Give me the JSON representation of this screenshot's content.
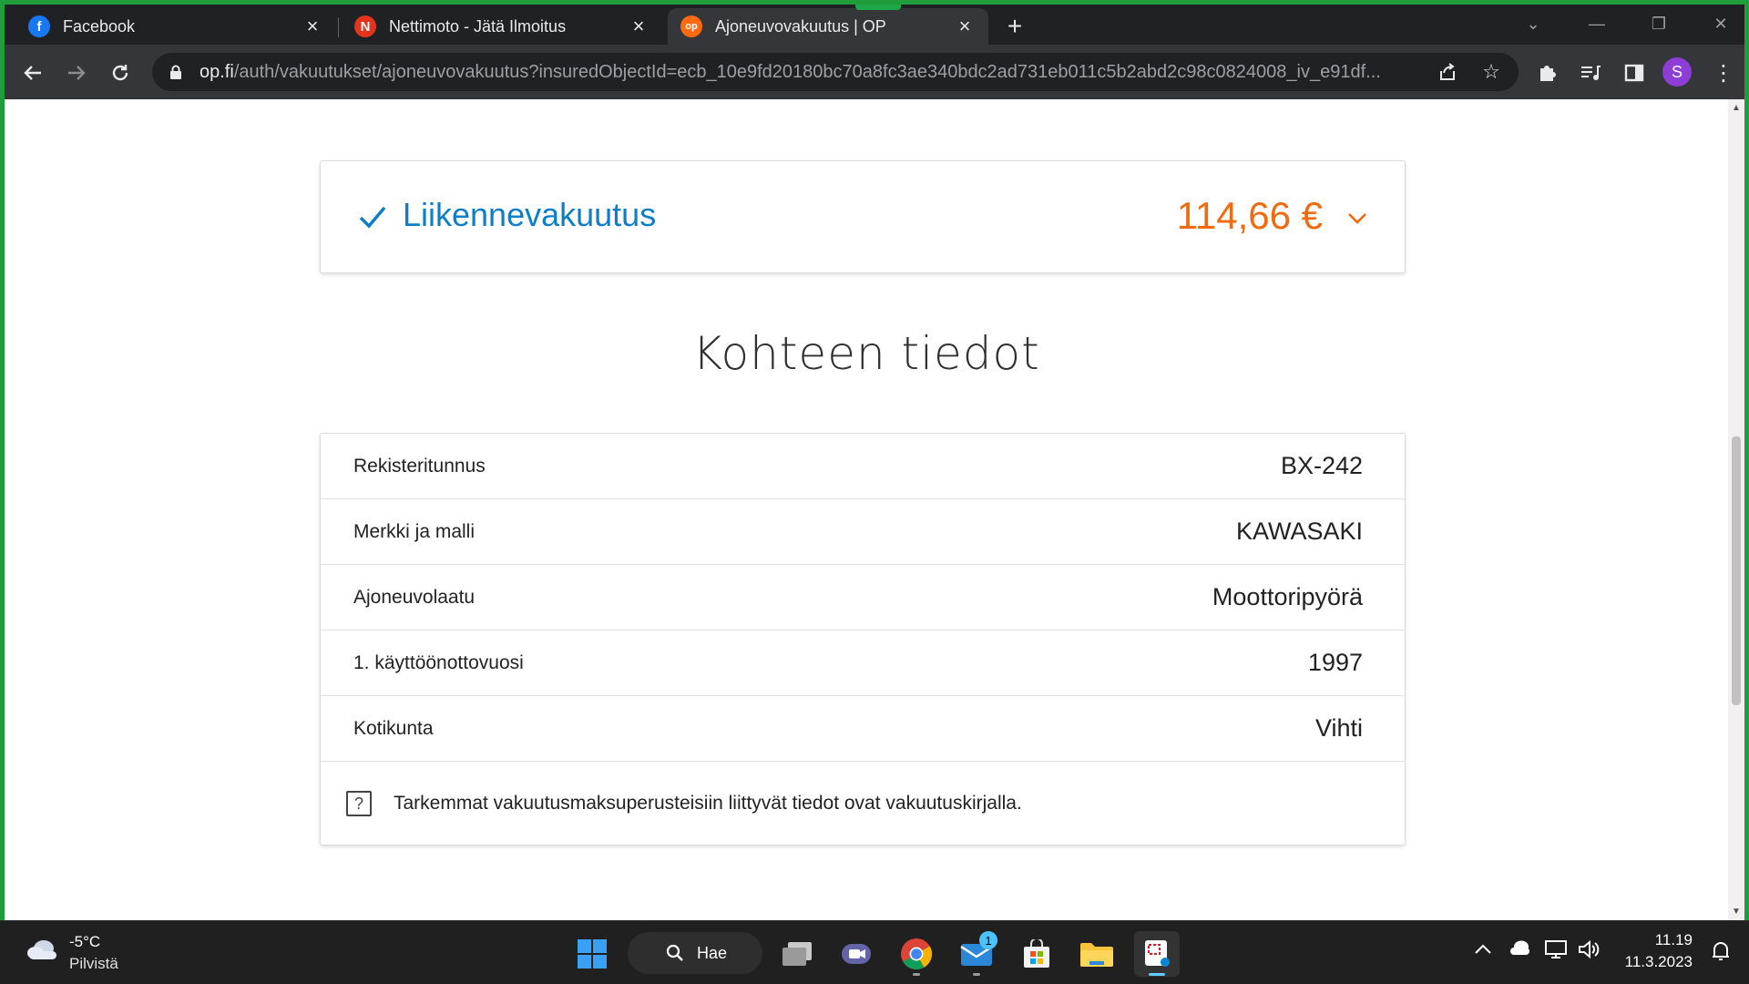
{
  "browser": {
    "tabs": [
      {
        "title": "Facebook",
        "favicon": "facebook-icon",
        "color": "#1877f2",
        "glyph": "f"
      },
      {
        "title": "Nettimoto - Jätä Ilmoitus",
        "favicon": "nettimoto-icon",
        "color": "#e5341b",
        "glyph": "N"
      },
      {
        "title": "Ajoneuvovakuutus | OP",
        "favicon": "op-icon",
        "color": "#ff6a10",
        "glyph": "op"
      }
    ],
    "url_host": "op.fi",
    "url_path": "/auth/vakuutukset/ajoneuvovakuutus?insuredObjectId=ecb_10e9fd20180bc70a8fc3ae340bdc2ad731eb011c5b2abd2c98c0824008_iv_e91df...",
    "profile_initial": "S"
  },
  "insurance": {
    "title": "Liikennevakuutus",
    "price": "114,66 €",
    "accent": "#0d7fc8",
    "price_color": "#f06a0f"
  },
  "details": {
    "heading": "Kohteen tiedot",
    "rows": [
      {
        "label": "Rekisteritunnus",
        "value": "BX-242"
      },
      {
        "label": "Merkki ja malli",
        "value": "KAWASAKI"
      },
      {
        "label": "Ajoneuvolaatu",
        "value": "Moottoripyörä"
      },
      {
        "label": "1. käyttöönottovuosi",
        "value": "1997"
      },
      {
        "label": "Kotikunta",
        "value": "Vihti"
      }
    ],
    "note": "Tarkemmat vakuutusmaksuperusteisiin liittyvät tiedot ovat vakuutuskirjalla."
  },
  "taskbar": {
    "weather_temp": "-5°C",
    "weather_cond": "Pilvistä",
    "search_label": "Hae",
    "mail_badge": "1",
    "time": "11.19",
    "date": "11.3.2023"
  }
}
